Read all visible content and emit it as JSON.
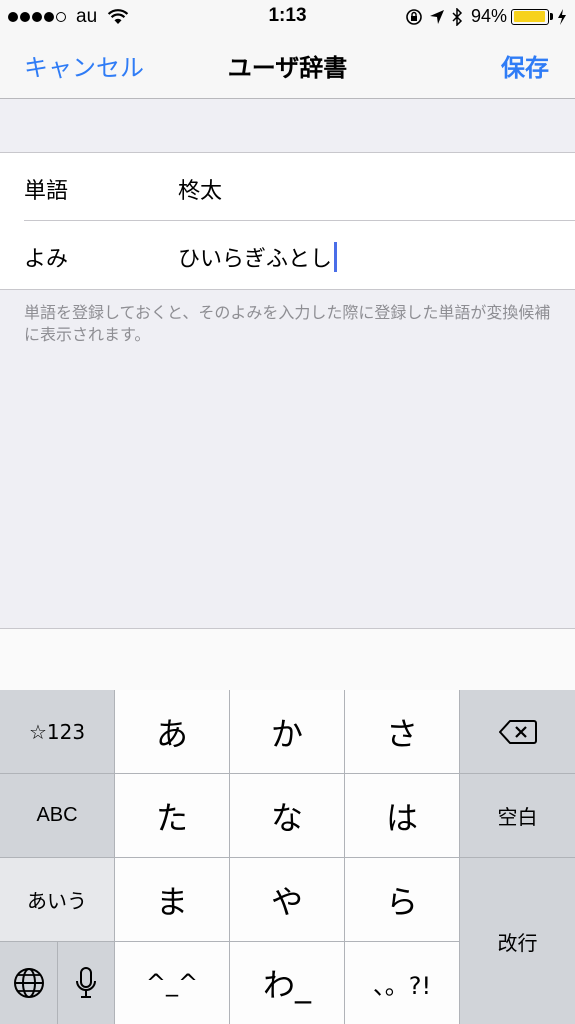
{
  "status_bar": {
    "carrier": "au",
    "time": "1:13",
    "battery_percent": "94%",
    "battery_level": 0.94,
    "battery_color": "#f7d21c"
  },
  "nav": {
    "cancel_label": "キャンセル",
    "title": "ユーザ辞書",
    "save_label": "保存",
    "accent_color": "#2f7cf6"
  },
  "form": {
    "word_label": "単語",
    "word_value": "柊太",
    "reading_label": "よみ",
    "reading_value": "ひいらぎふとし",
    "hint": "単語を登録しておくと、そのよみを入力した際に登録した単語が変換候補に表示されます。"
  },
  "keyboard": {
    "mode_numbers": "☆123",
    "mode_abc": "ABC",
    "mode_kana": "あいう",
    "row1": [
      "あ",
      "か",
      "さ"
    ],
    "row2": [
      "た",
      "な",
      "は"
    ],
    "row3": [
      "ま",
      "や",
      "ら"
    ],
    "row4": [
      "^_^",
      "わ_",
      "、。?!"
    ],
    "space_label": "空白",
    "return_label": "改行",
    "icons": [
      "globe-icon",
      "microphone-icon",
      "backspace-icon"
    ]
  }
}
